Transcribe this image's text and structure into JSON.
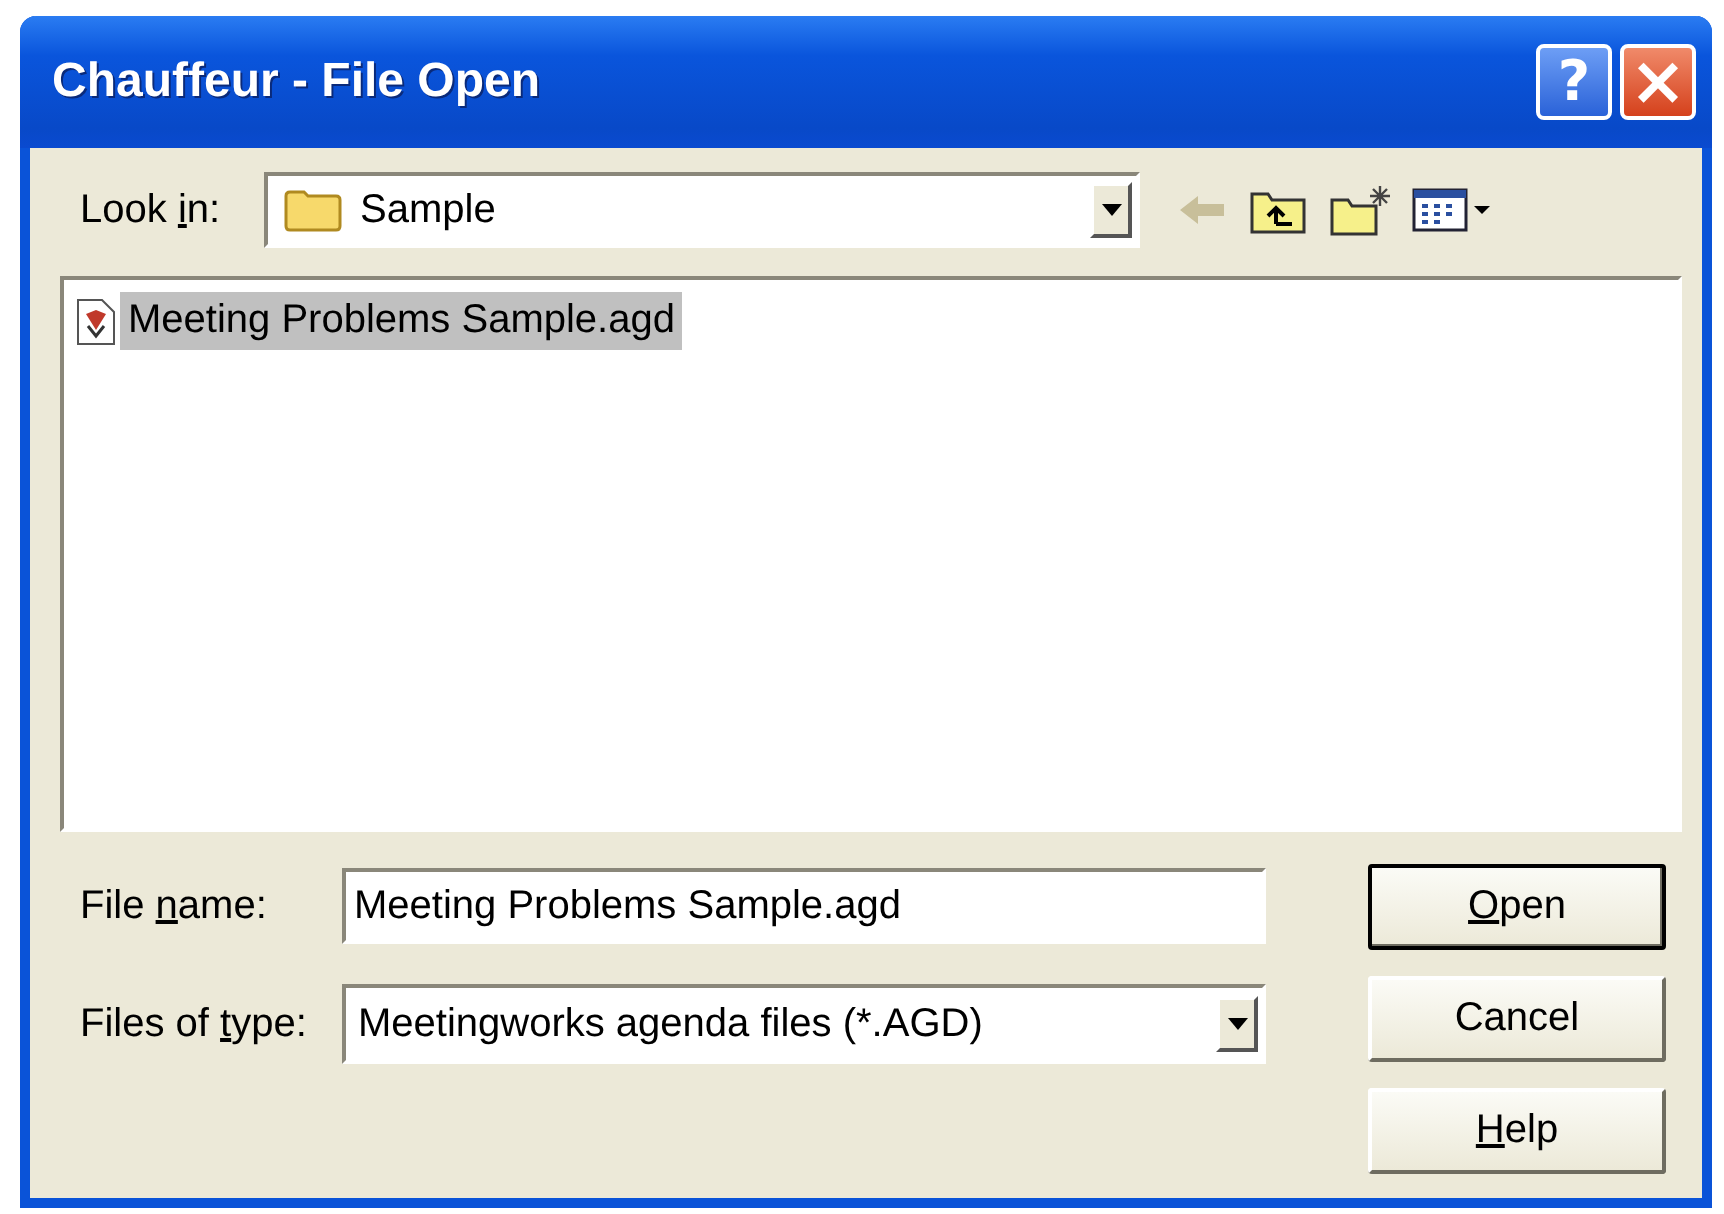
{
  "window": {
    "title": "Chauffeur - File Open",
    "title_buttons": [
      {
        "kind": "help",
        "label": "?"
      },
      {
        "kind": "close",
        "label": "×"
      }
    ]
  },
  "look_in": {
    "label": {
      "before": "Look ",
      "key": "i",
      "after": "n:"
    },
    "value": "Sample"
  },
  "toolbar": [
    {
      "kind": "back",
      "disabled": true
    },
    {
      "kind": "up",
      "disabled": false
    },
    {
      "kind": "new-folder",
      "disabled": false
    },
    {
      "kind": "view-menu",
      "disabled": false
    }
  ],
  "files": [
    {
      "name": "Meeting Problems Sample.agd",
      "selected": true
    }
  ],
  "file_name": {
    "label": {
      "before": "File ",
      "key": "n",
      "after": "ame:"
    },
    "value": "Meeting Problems Sample.agd"
  },
  "file_type": {
    "label": {
      "before": "Files of ",
      "key": "t",
      "after": "ype:"
    },
    "value": "Meetingworks agenda files (*.AGD)"
  },
  "buttons": [
    {
      "label": {
        "key": "O",
        "after": "pen"
      },
      "default": true
    },
    {
      "label": {
        "before": "Cancel"
      },
      "default": false
    },
    {
      "label": {
        "key": "H",
        "after": "elp"
      },
      "default": false
    }
  ]
}
